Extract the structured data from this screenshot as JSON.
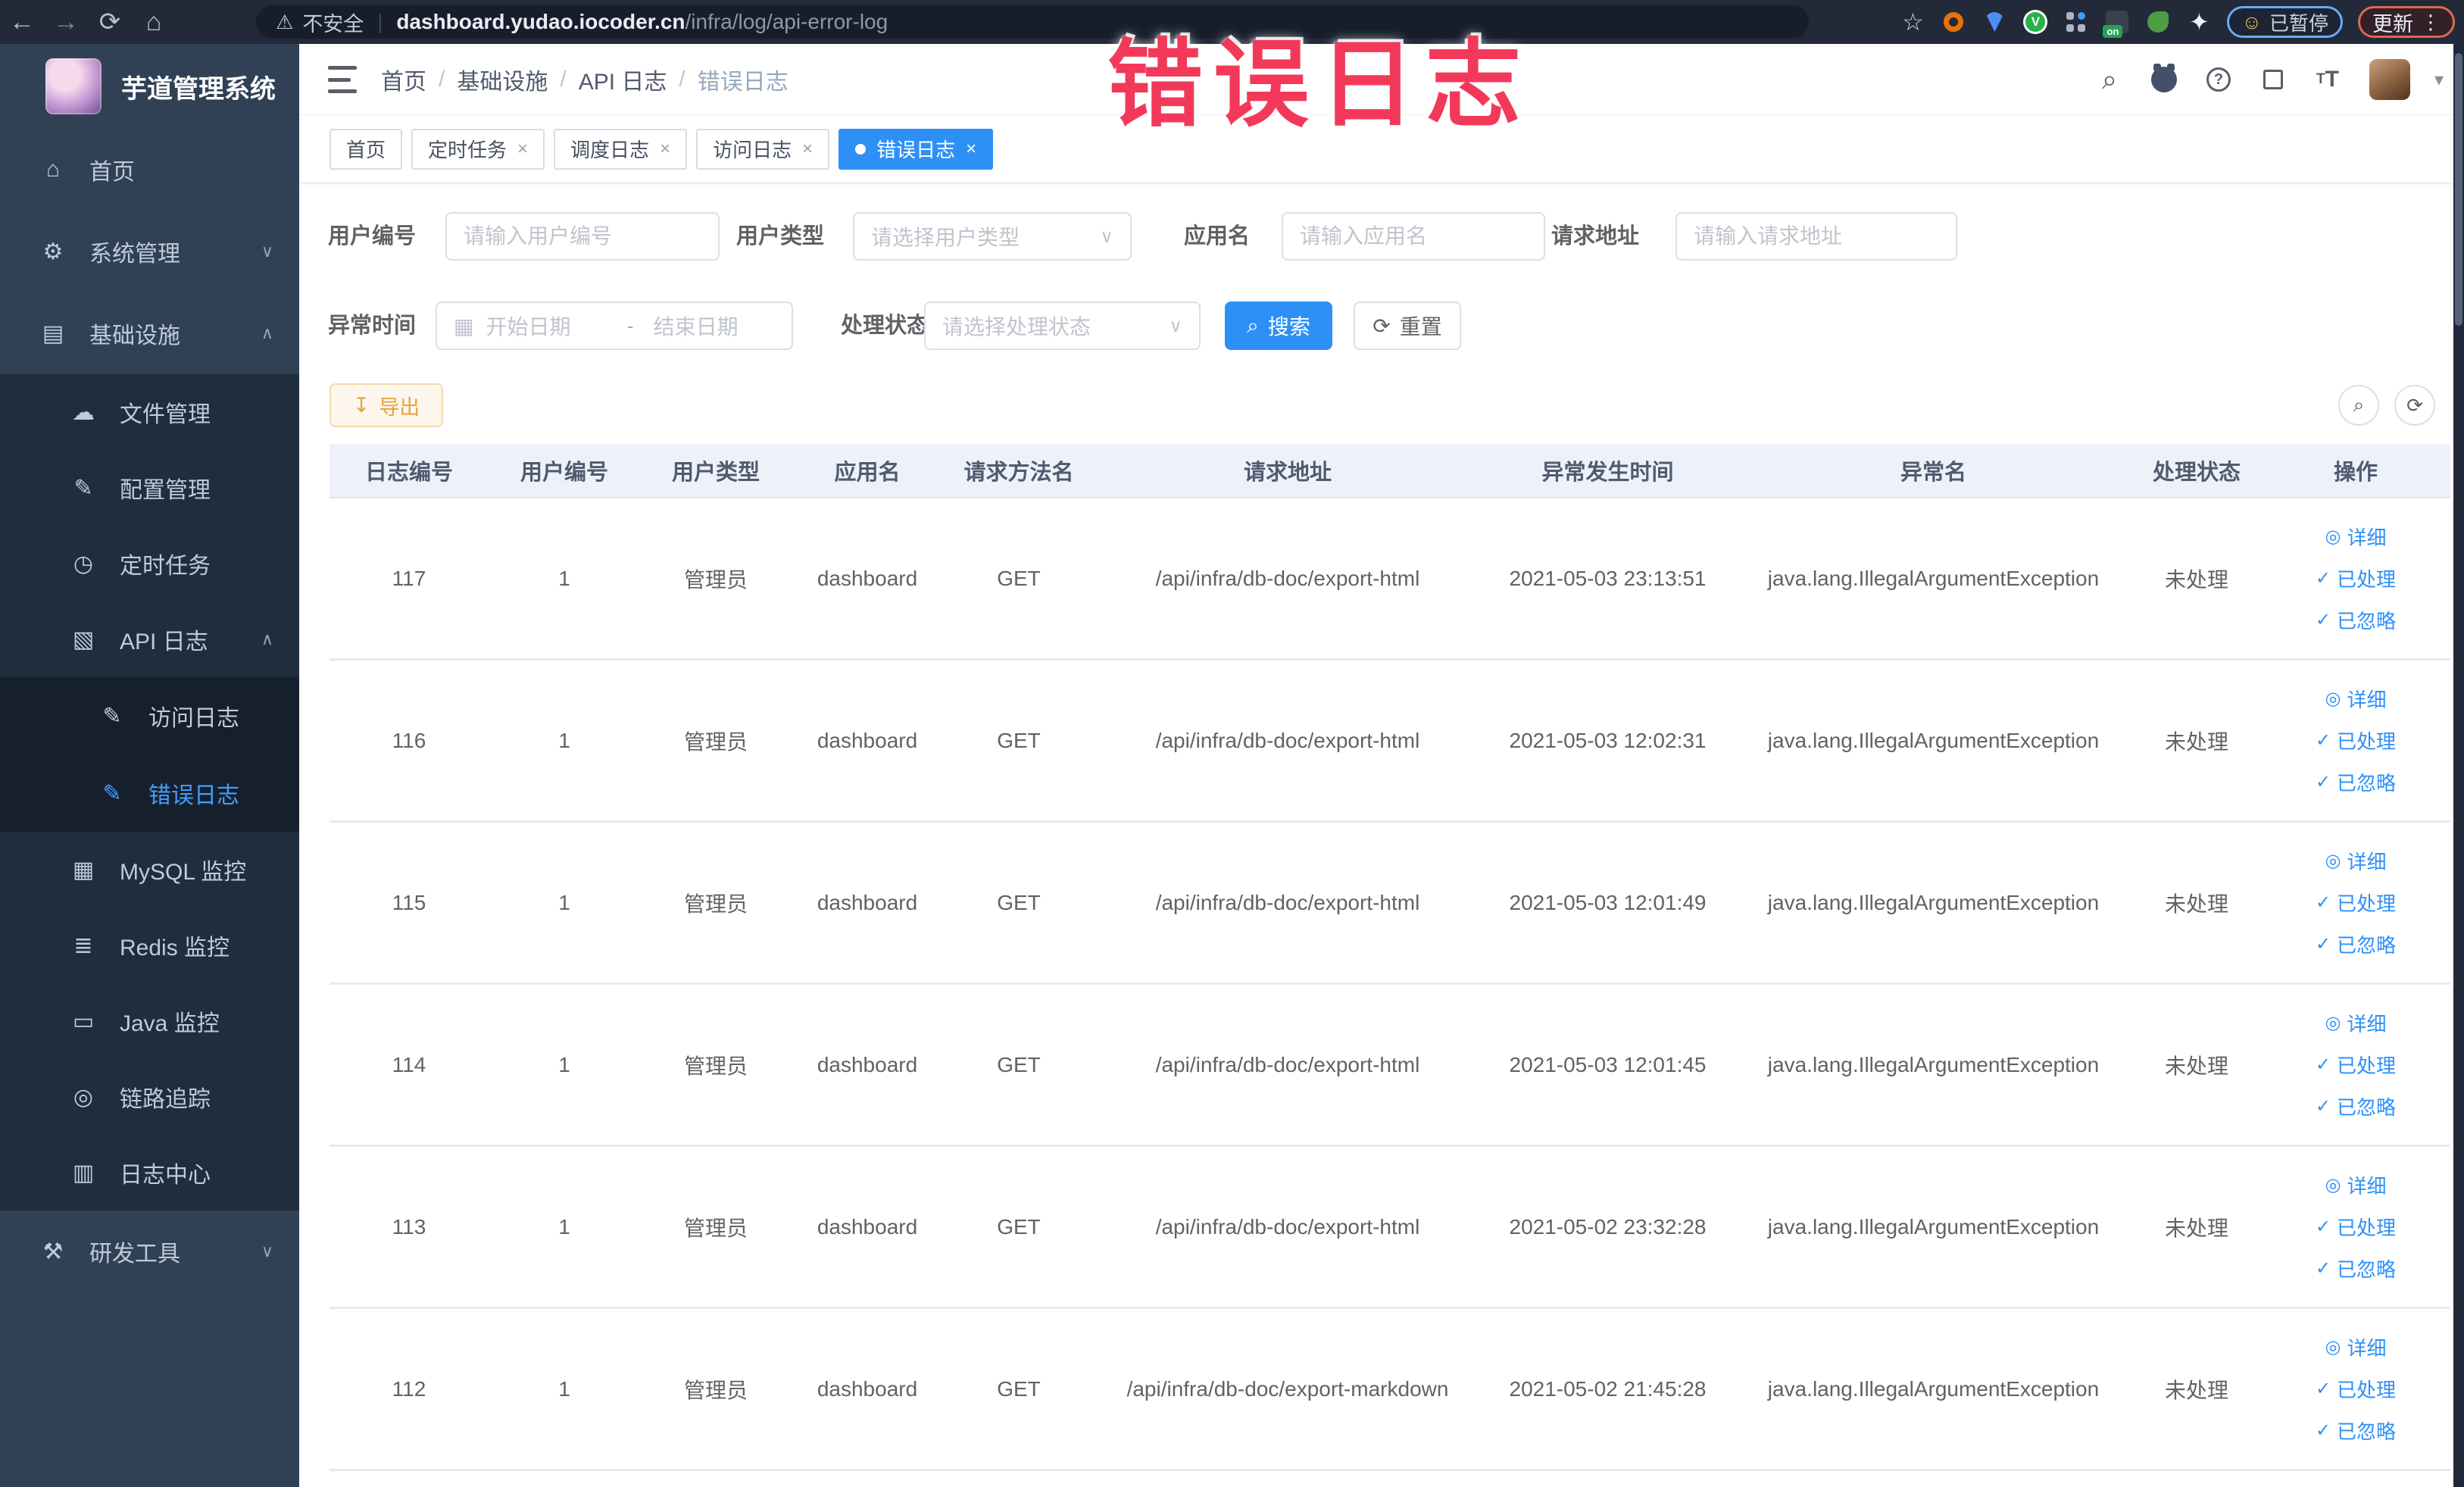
{
  "colors": {
    "accent": "#409eff",
    "annotation_red": "#f2395a",
    "sidebar_bg": "#304156",
    "submenu_bg": "#1f2d3d",
    "warning_btn": "#e6a23c"
  },
  "chrome": {
    "back_glyph": "←",
    "forward_glyph": "→",
    "reload_glyph": "⟳",
    "home_glyph": "⌂",
    "warning_glyph": "⚠",
    "security_text": "不安全",
    "divider_glyph": "|",
    "url_host": "dashboard.yudao.iocoder.cn",
    "url_path": "/infra/log/api-error-log",
    "bookmark_glyph": "☆",
    "puzzle_glyph": "✦",
    "grid_check": "V",
    "paused_face_glyph": "☺",
    "paused_label": "已暂停",
    "on_badge": "on",
    "update_label": "更新",
    "kebab_glyph": "⋮"
  },
  "sidebar": {
    "title": "芋道管理系统",
    "items": [
      {
        "name": "home",
        "label": "首页",
        "glyph": "⌂",
        "depth": 1
      },
      {
        "name": "system",
        "label": "系统管理",
        "glyph": "⚙",
        "depth": 1,
        "chevron": "∨"
      },
      {
        "name": "infra",
        "label": "基础设施",
        "glyph": "▤",
        "depth": 1,
        "chevron": "∧"
      },
      {
        "name": "file",
        "label": "文件管理",
        "glyph": "☁",
        "depth": 2
      },
      {
        "name": "config",
        "label": "配置管理",
        "glyph": "✎",
        "depth": 2
      },
      {
        "name": "job",
        "label": "定时任务",
        "glyph": "◷",
        "depth": 2
      },
      {
        "name": "api-log",
        "label": "API 日志",
        "glyph": "▧",
        "depth": 2,
        "chevron": "∧"
      },
      {
        "name": "access-log",
        "label": "访问日志",
        "glyph": "✎",
        "depth": 3
      },
      {
        "name": "error-log",
        "label": "错误日志",
        "glyph": "✎",
        "depth": 3,
        "active": true
      },
      {
        "name": "mysql",
        "label": "MySQL 监控",
        "glyph": "▦",
        "depth": 2
      },
      {
        "name": "redis",
        "label": "Redis 监控",
        "glyph": "≣",
        "depth": 2
      },
      {
        "name": "java",
        "label": "Java 监控",
        "glyph": "▭",
        "depth": 2
      },
      {
        "name": "trace",
        "label": "链路追踪",
        "glyph": "◎",
        "depth": 2
      },
      {
        "name": "log-center",
        "label": "日志中心",
        "glyph": "▥",
        "depth": 2
      },
      {
        "name": "dev-tools",
        "label": "研发工具",
        "glyph": "⚒",
        "depth": 1,
        "chevron": "∨"
      }
    ]
  },
  "header": {
    "breadcrumb": [
      {
        "name": "home",
        "label": "首页"
      },
      {
        "name": "infra",
        "label": "基础设施"
      },
      {
        "name": "api-log",
        "label": "API 日志"
      },
      {
        "name": "error-log",
        "label": "错误日志",
        "last": true
      }
    ],
    "separator": "/",
    "search_glyph": "⌕",
    "help_glyph": "?",
    "caret_glyph": "▾",
    "font_big": "T",
    "font_small": "T"
  },
  "tabs": [
    {
      "name": "home",
      "label": "首页"
    },
    {
      "name": "job",
      "label": "定时任务",
      "closable": true
    },
    {
      "name": "job-log",
      "label": "调度日志",
      "closable": true
    },
    {
      "name": "access-log",
      "label": "访问日志",
      "closable": true
    },
    {
      "name": "error-log",
      "label": "错误日志",
      "closable": true,
      "active": true
    }
  ],
  "filters": {
    "user_id": {
      "label": "用户编号",
      "placeholder": "请输入用户编号"
    },
    "user_type": {
      "label": "用户类型",
      "placeholder": "请选择用户类型"
    },
    "app_name": {
      "label": "应用名",
      "placeholder": "请输入应用名"
    },
    "request_url": {
      "label": "请求地址",
      "placeholder": "请输入请求地址"
    },
    "exception_time": {
      "label": "异常时间",
      "start_placeholder": "开始日期",
      "range_separator": "-",
      "end_placeholder": "结束日期",
      "calendar_glyph": "▦"
    },
    "process_status": {
      "label": "处理状态",
      "placeholder": "请选择处理状态"
    },
    "search_label": "搜索",
    "search_glyph": "⌕",
    "reset_label": "重置",
    "reset_glyph": "⟳",
    "select_chevron": "∨"
  },
  "toolbar": {
    "export_label": "导出",
    "export_glyph": "↧",
    "search_toggle_glyph": "⌕",
    "refresh_glyph": "⟳"
  },
  "table": {
    "columns": [
      "日志编号",
      "用户编号",
      "用户类型",
      "应用名",
      "请求方法名",
      "请求地址",
      "异常发生时间",
      "异常名",
      "处理状态",
      "操作"
    ],
    "actions": [
      {
        "label": "详细",
        "glyph": "◎"
      },
      {
        "label": "已处理",
        "glyph": "✓"
      },
      {
        "label": "已忽略",
        "glyph": "✓"
      }
    ],
    "rows": [
      {
        "id": "117",
        "user_id": "1",
        "user_type": "管理员",
        "app_name": "dashboard",
        "method": "GET",
        "url": "/api/infra/db-doc/export-html",
        "time": "2021-05-03 23:13:51",
        "exception": "java.lang.IllegalArgumentException",
        "status": "未处理"
      },
      {
        "id": "116",
        "user_id": "1",
        "user_type": "管理员",
        "app_name": "dashboard",
        "method": "GET",
        "url": "/api/infra/db-doc/export-html",
        "time": "2021-05-03 12:02:31",
        "exception": "java.lang.IllegalArgumentException",
        "status": "未处理"
      },
      {
        "id": "115",
        "user_id": "1",
        "user_type": "管理员",
        "app_name": "dashboard",
        "method": "GET",
        "url": "/api/infra/db-doc/export-html",
        "time": "2021-05-03 12:01:49",
        "exception": "java.lang.IllegalArgumentException",
        "status": "未处理"
      },
      {
        "id": "114",
        "user_id": "1",
        "user_type": "管理员",
        "app_name": "dashboard",
        "method": "GET",
        "url": "/api/infra/db-doc/export-html",
        "time": "2021-05-03 12:01:45",
        "exception": "java.lang.IllegalArgumentException",
        "status": "未处理"
      },
      {
        "id": "113",
        "user_id": "1",
        "user_type": "管理员",
        "app_name": "dashboard",
        "method": "GET",
        "url": "/api/infra/db-doc/export-html",
        "time": "2021-05-02 23:32:28",
        "exception": "java.lang.IllegalArgumentException",
        "status": "未处理"
      },
      {
        "id": "112",
        "user_id": "1",
        "user_type": "管理员",
        "app_name": "dashboard",
        "method": "GET",
        "url": "/api/infra/db-doc/export-markdown",
        "time": "2021-05-02 21:45:28",
        "exception": "java.lang.IllegalArgumentException",
        "status": "未处理"
      }
    ]
  },
  "annotation": {
    "text": "错误日志"
  }
}
